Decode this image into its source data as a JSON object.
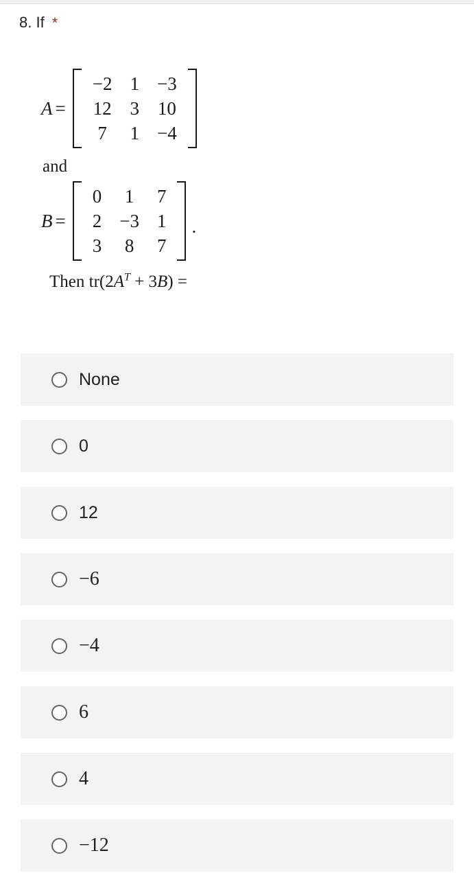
{
  "question": {
    "number": "8.",
    "prompt": "If",
    "required_marker": "*",
    "required_color": "#8c2f26"
  },
  "math": {
    "matrix_a": {
      "label": "A",
      "equals": "=",
      "rows": [
        [
          "−2",
          "1",
          "−3"
        ],
        [
          "12",
          "3",
          "10"
        ],
        [
          "7",
          "1",
          "−4"
        ]
      ]
    },
    "conjunction": "and",
    "matrix_b": {
      "label": "B",
      "equals": "=",
      "rows": [
        [
          "0",
          "1",
          "7"
        ],
        [
          "2",
          "−3",
          "1"
        ],
        [
          "3",
          "8",
          "7"
        ]
      ],
      "trailing_punctuation": "."
    },
    "expression": {
      "lead": "Then tr(2",
      "var_a": "A",
      "exponent": "T",
      "plus": " + 3",
      "var_b": "B",
      "close": ") ="
    }
  },
  "options": [
    {
      "label": "None",
      "style": "sans",
      "selected": false
    },
    {
      "label": "0",
      "style": "sans",
      "selected": false
    },
    {
      "label": "12",
      "style": "sans",
      "selected": false
    },
    {
      "label": "−6",
      "style": "serif",
      "selected": false
    },
    {
      "label": "−4",
      "style": "serif",
      "selected": false
    },
    {
      "label": "6",
      "style": "serif",
      "selected": false
    },
    {
      "label": "4",
      "style": "serif",
      "selected": false
    },
    {
      "label": "−12",
      "style": "serif",
      "selected": false
    }
  ],
  "theme": {
    "option_background": "#f3f3f3",
    "text_color": "#202124",
    "radio_border": "#62666b",
    "page_background": "#ffffff"
  }
}
